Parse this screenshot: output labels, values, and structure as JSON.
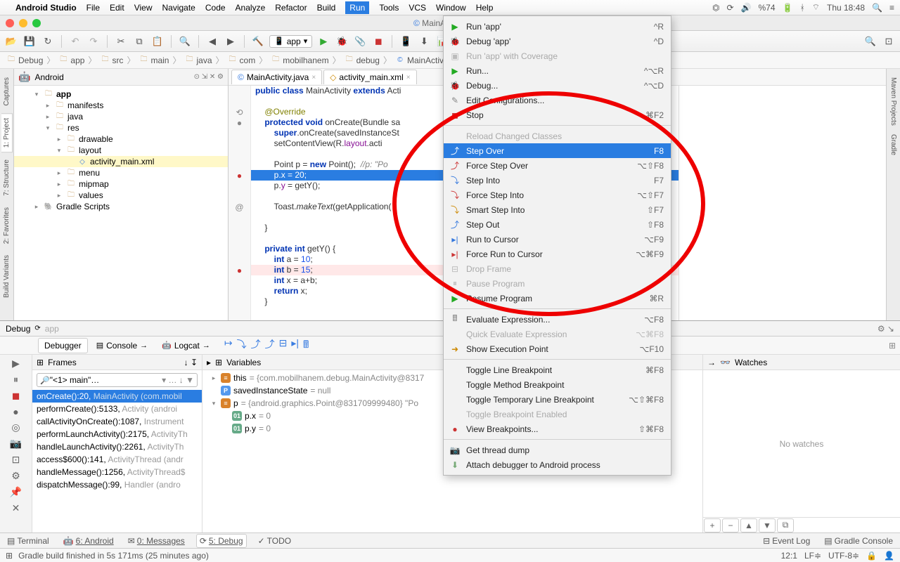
{
  "menubar": {
    "app": "Android Studio",
    "items": [
      "File",
      "Edit",
      "View",
      "Navigate",
      "Code",
      "Analyze",
      "Refactor",
      "Build",
      "Run",
      "Tools",
      "VCS",
      "Window",
      "Help"
    ],
    "open_index": 8,
    "battery": "%74",
    "clock": "Thu 18:48"
  },
  "window_title": "MainActivity.java - Debug -",
  "run_config": "app",
  "breadcrumb": [
    "Debug",
    "app",
    "src",
    "main",
    "java",
    "com",
    "mobilhanem",
    "debug",
    "MainActivity"
  ],
  "project": {
    "header": "Android",
    "tree": [
      {
        "depth": 0,
        "tw": "▾",
        "icon": "folder",
        "label": "app",
        "bold": true
      },
      {
        "depth": 1,
        "tw": "▸",
        "icon": "folder",
        "label": "manifests"
      },
      {
        "depth": 1,
        "tw": "▸",
        "icon": "folder",
        "label": "java"
      },
      {
        "depth": 1,
        "tw": "▾",
        "icon": "folder",
        "label": "res"
      },
      {
        "depth": 2,
        "tw": "▸",
        "icon": "folder",
        "label": "drawable"
      },
      {
        "depth": 2,
        "tw": "▾",
        "icon": "folder",
        "label": "layout"
      },
      {
        "depth": 3,
        "tw": "",
        "icon": "xml",
        "label": "activity_main.xml",
        "sel": true
      },
      {
        "depth": 2,
        "tw": "▸",
        "icon": "folder",
        "label": "menu"
      },
      {
        "depth": 2,
        "tw": "▸",
        "icon": "folder",
        "label": "mipmap"
      },
      {
        "depth": 2,
        "tw": "▸",
        "icon": "folder",
        "label": "values"
      },
      {
        "depth": 0,
        "tw": "▸",
        "icon": "gradle",
        "label": "Gradle Scripts"
      }
    ]
  },
  "editor_tabs": [
    {
      "label": "MainActivity.java",
      "icon": "c"
    },
    {
      "label": "activity_main.xml",
      "icon": "x"
    }
  ],
  "code": [
    {
      "t": "public class MainActivity extends Acti",
      "cls": ""
    },
    {
      "t": "",
      "cls": ""
    },
    {
      "t": "    @Override",
      "cls": "ann"
    },
    {
      "t": "    protected void onCreate(Bundle sa",
      "cls": ""
    },
    {
      "t": "        super.onCreate(savedInstanceSt",
      "cls": ""
    },
    {
      "t": "        setContentView(R.layout.acti",
      "cls": ""
    },
    {
      "t": "",
      "cls": ""
    },
    {
      "t": "        Point p = new Point();  //p: \"Po",
      "cls": ""
    },
    {
      "t": "        p.x = 20;",
      "cls": "exec"
    },
    {
      "t": "        p.y = getY();",
      "cls": ""
    },
    {
      "t": "",
      "cls": ""
    },
    {
      "t": "        Toast.makeText(getApplication(                               );",
      "cls": ""
    },
    {
      "t": "",
      "cls": ""
    },
    {
      "t": "    }",
      "cls": ""
    },
    {
      "t": "",
      "cls": ""
    },
    {
      "t": "    private int getY() {",
      "cls": ""
    },
    {
      "t": "        int a = 10;",
      "cls": ""
    },
    {
      "t": "        int b = 15;",
      "cls": "err"
    },
    {
      "t": "        int x = a+b;",
      "cls": ""
    },
    {
      "t": "        return x;",
      "cls": ""
    },
    {
      "t": "    }",
      "cls": ""
    }
  ],
  "debug": {
    "title": "Debug",
    "app": "app",
    "debugger_tab": "Debugger",
    "console_tab": "Console",
    "logcat_tab": "Logcat",
    "frames_title": "Frames",
    "vars_title": "Variables",
    "watches_title": "Watches",
    "thread": "\"<1> main\"…",
    "frames": [
      {
        "t": "onCreate():20, MainActivity (com.mobil",
        "sel": true
      },
      {
        "t": "performCreate():5133, Activity (androi"
      },
      {
        "t": "callActivityOnCreate():1087, Instrument"
      },
      {
        "t": "performLaunchActivity():2175, ActivityTh"
      },
      {
        "t": "handleLaunchActivity():2261, ActivityTh"
      },
      {
        "t": "access$600():141, ActivityThread (andr"
      },
      {
        "t": "handleMessage():1256, ActivityThread$"
      },
      {
        "t": "dispatchMessage():99, Handler (andro"
      }
    ],
    "vars": [
      {
        "k": "obj",
        "tw": "▸",
        "name": "this",
        "val": " = {com.mobilhanem.debug.MainActivity@8317"
      },
      {
        "k": "param",
        "tw": "",
        "name": "savedInstanceState",
        "val": " = null"
      },
      {
        "k": "obj",
        "tw": "▾",
        "name": "p",
        "val": " = {android.graphics.Point@831709999480} \"Po"
      },
      {
        "k": "prim",
        "tw": "",
        "name": "p.x",
        "val": " = 0",
        "ind": 1
      },
      {
        "k": "prim",
        "tw": "",
        "name": "p.y",
        "val": " = 0",
        "ind": 1
      }
    ],
    "no_watches": "No watches"
  },
  "runmenu": [
    {
      "icon": "▶",
      "color": "#2a2",
      "label": "Run 'app'",
      "short": "^R"
    },
    {
      "icon": "🐞",
      "color": "#7a7",
      "label": "Debug 'app'",
      "short": "^D"
    },
    {
      "icon": "▣",
      "color": "#bbb",
      "label": "Run 'app' with Coverage",
      "disabled": true
    },
    {
      "icon": "▶",
      "color": "#2a2",
      "label": "Run...",
      "short": "^⌥R"
    },
    {
      "icon": "🐞",
      "color": "#7a7",
      "label": "Debug...",
      "short": "^⌥D"
    },
    {
      "icon": "✎",
      "color": "#888",
      "label": "Edit Configurations..."
    },
    {
      "icon": "◼",
      "color": "#c33",
      "label": "Stop",
      "short": "⌘F2"
    },
    {
      "sep": true
    },
    {
      "icon": "",
      "label": "Reload Changed Classes",
      "disabled": true
    },
    {
      "icon": "⤴",
      "color": "#fff",
      "label": "Step Over",
      "short": "F8",
      "hl": true
    },
    {
      "icon": "⤴",
      "color": "#c33",
      "label": "Force Step Over",
      "short": "⌥⇧F8"
    },
    {
      "icon": "⤵",
      "color": "#37d",
      "label": "Step Into",
      "short": "F7"
    },
    {
      "icon": "⤵",
      "color": "#c33",
      "label": "Force Step Into",
      "short": "⌥⇧F7"
    },
    {
      "icon": "⤵",
      "color": "#c80",
      "label": "Smart Step Into",
      "short": "⇧F7"
    },
    {
      "icon": "⤴",
      "color": "#37d",
      "label": "Step Out",
      "short": "⇧F8"
    },
    {
      "icon": "▸|",
      "color": "#37d",
      "label": "Run to Cursor",
      "short": "⌥F9"
    },
    {
      "icon": "▸|",
      "color": "#c33",
      "label": "Force Run to Cursor",
      "short": "⌥⌘F9"
    },
    {
      "icon": "⊟",
      "color": "#bbb",
      "label": "Drop Frame",
      "disabled": true
    },
    {
      "icon": "⏸",
      "color": "#bbb",
      "label": "Pause Program",
      "disabled": true
    },
    {
      "icon": "▶",
      "color": "#2a2",
      "label": "Resume Program",
      "short": "⌘R"
    },
    {
      "sep": true
    },
    {
      "icon": "🖩",
      "color": "#888",
      "label": "Evaluate Expression...",
      "short": "⌥F8"
    },
    {
      "icon": "",
      "label": "Quick Evaluate Expression",
      "short": "⌥⌘F8",
      "disabled": true
    },
    {
      "icon": "➜",
      "color": "#c80",
      "label": "Show Execution Point",
      "short": "⌥F10"
    },
    {
      "sep": true
    },
    {
      "icon": "",
      "label": "Toggle Line Breakpoint",
      "short": "⌘F8"
    },
    {
      "icon": "",
      "label": "Toggle Method Breakpoint"
    },
    {
      "icon": "",
      "label": "Toggle Temporary Line Breakpoint",
      "short": "⌥⇧⌘F8"
    },
    {
      "icon": "",
      "label": "Toggle Breakpoint Enabled",
      "disabled": true
    },
    {
      "icon": "●",
      "color": "#c33",
      "label": "View Breakpoints...",
      "short": "⇧⌘F8"
    },
    {
      "sep": true
    },
    {
      "icon": "📷",
      "color": "#888",
      "label": "Get thread dump"
    },
    {
      "icon": "⬇",
      "color": "#7a7",
      "label": "Attach debugger to Android process"
    }
  ],
  "bottom": {
    "terminal": "Terminal",
    "android": "6: Android",
    "messages": "0: Messages",
    "debug": "5: Debug",
    "todo": "TODO",
    "eventlog": "Event Log",
    "gradlecon": "Gradle Console"
  },
  "status": {
    "msg": "Gradle build finished in 5s 171ms (25 minutes ago)",
    "pos": "12:1",
    "le": "LF≑",
    "enc": "UTF-8≑"
  },
  "side_tabs_left": [
    "Captures",
    "1: Project",
    "7: Structure",
    "2: Favorites",
    "Build Variants"
  ],
  "side_tabs_right": [
    "Maven Projects",
    "Gradle"
  ]
}
